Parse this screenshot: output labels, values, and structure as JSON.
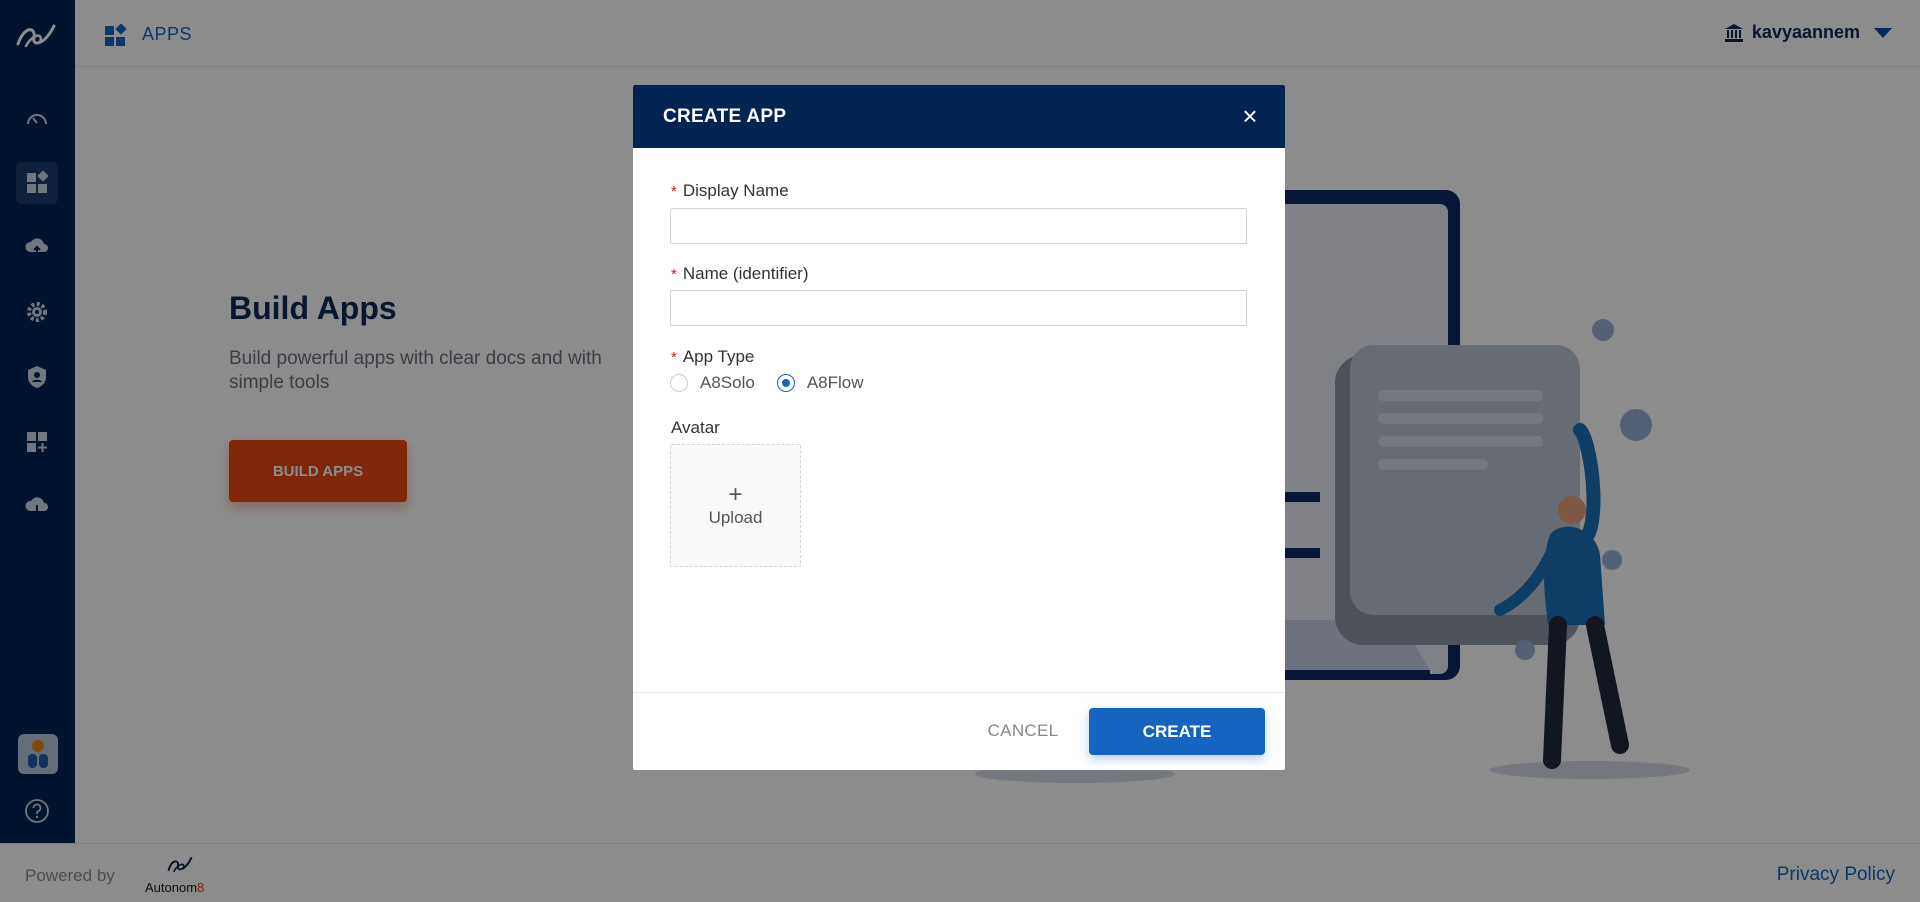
{
  "header": {
    "app_title": "APPS",
    "username": "kavyaannem"
  },
  "hero": {
    "title": "Build Apps",
    "subtitle": "Build powerful apps with clear docs and with simple tools",
    "button_label": "BUILD APPS"
  },
  "footer": {
    "powered_by": "Powered by",
    "brand": "Autonom",
    "brand_suffix": "8",
    "privacy": "Privacy Policy"
  },
  "modal": {
    "title": "CREATE APP",
    "close_icon": "close-icon",
    "fields": {
      "display_name_label": "Display Name",
      "display_name_value": "",
      "name_label": "Name (identifier)",
      "name_value": "",
      "app_type_label": "App Type",
      "app_type_options": [
        "A8Solo",
        "A8Flow"
      ],
      "app_type_selected": "A8Flow",
      "avatar_label": "Avatar",
      "upload_label": "Upload"
    },
    "cancel_label": "CANCEL",
    "create_label": "CREATE"
  },
  "colors": {
    "sidebar": "#022453",
    "accent": "#1565c0",
    "hero_button": "#e8470f"
  }
}
